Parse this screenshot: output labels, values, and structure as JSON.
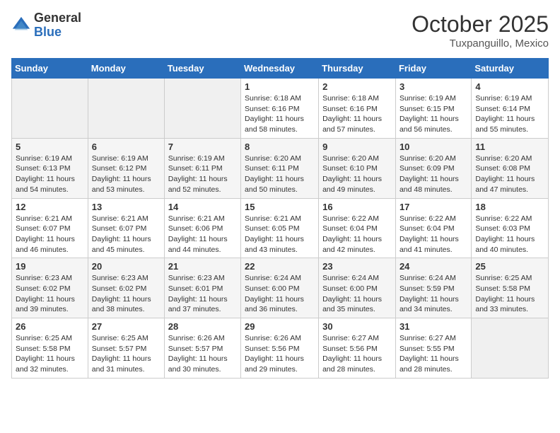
{
  "header": {
    "logo_general": "General",
    "logo_blue": "Blue",
    "month": "October 2025",
    "location": "Tuxpanguillo, Mexico"
  },
  "days_of_week": [
    "Sunday",
    "Monday",
    "Tuesday",
    "Wednesday",
    "Thursday",
    "Friday",
    "Saturday"
  ],
  "weeks": [
    [
      {
        "day": "",
        "info": ""
      },
      {
        "day": "",
        "info": ""
      },
      {
        "day": "",
        "info": ""
      },
      {
        "day": "1",
        "info": "Sunrise: 6:18 AM\nSunset: 6:16 PM\nDaylight: 11 hours\nand 58 minutes."
      },
      {
        "day": "2",
        "info": "Sunrise: 6:18 AM\nSunset: 6:16 PM\nDaylight: 11 hours\nand 57 minutes."
      },
      {
        "day": "3",
        "info": "Sunrise: 6:19 AM\nSunset: 6:15 PM\nDaylight: 11 hours\nand 56 minutes."
      },
      {
        "day": "4",
        "info": "Sunrise: 6:19 AM\nSunset: 6:14 PM\nDaylight: 11 hours\nand 55 minutes."
      }
    ],
    [
      {
        "day": "5",
        "info": "Sunrise: 6:19 AM\nSunset: 6:13 PM\nDaylight: 11 hours\nand 54 minutes."
      },
      {
        "day": "6",
        "info": "Sunrise: 6:19 AM\nSunset: 6:12 PM\nDaylight: 11 hours\nand 53 minutes."
      },
      {
        "day": "7",
        "info": "Sunrise: 6:19 AM\nSunset: 6:11 PM\nDaylight: 11 hours\nand 52 minutes."
      },
      {
        "day": "8",
        "info": "Sunrise: 6:20 AM\nSunset: 6:11 PM\nDaylight: 11 hours\nand 50 minutes."
      },
      {
        "day": "9",
        "info": "Sunrise: 6:20 AM\nSunset: 6:10 PM\nDaylight: 11 hours\nand 49 minutes."
      },
      {
        "day": "10",
        "info": "Sunrise: 6:20 AM\nSunset: 6:09 PM\nDaylight: 11 hours\nand 48 minutes."
      },
      {
        "day": "11",
        "info": "Sunrise: 6:20 AM\nSunset: 6:08 PM\nDaylight: 11 hours\nand 47 minutes."
      }
    ],
    [
      {
        "day": "12",
        "info": "Sunrise: 6:21 AM\nSunset: 6:07 PM\nDaylight: 11 hours\nand 46 minutes."
      },
      {
        "day": "13",
        "info": "Sunrise: 6:21 AM\nSunset: 6:07 PM\nDaylight: 11 hours\nand 45 minutes."
      },
      {
        "day": "14",
        "info": "Sunrise: 6:21 AM\nSunset: 6:06 PM\nDaylight: 11 hours\nand 44 minutes."
      },
      {
        "day": "15",
        "info": "Sunrise: 6:21 AM\nSunset: 6:05 PM\nDaylight: 11 hours\nand 43 minutes."
      },
      {
        "day": "16",
        "info": "Sunrise: 6:22 AM\nSunset: 6:04 PM\nDaylight: 11 hours\nand 42 minutes."
      },
      {
        "day": "17",
        "info": "Sunrise: 6:22 AM\nSunset: 6:04 PM\nDaylight: 11 hours\nand 41 minutes."
      },
      {
        "day": "18",
        "info": "Sunrise: 6:22 AM\nSunset: 6:03 PM\nDaylight: 11 hours\nand 40 minutes."
      }
    ],
    [
      {
        "day": "19",
        "info": "Sunrise: 6:23 AM\nSunset: 6:02 PM\nDaylight: 11 hours\nand 39 minutes."
      },
      {
        "day": "20",
        "info": "Sunrise: 6:23 AM\nSunset: 6:02 PM\nDaylight: 11 hours\nand 38 minutes."
      },
      {
        "day": "21",
        "info": "Sunrise: 6:23 AM\nSunset: 6:01 PM\nDaylight: 11 hours\nand 37 minutes."
      },
      {
        "day": "22",
        "info": "Sunrise: 6:24 AM\nSunset: 6:00 PM\nDaylight: 11 hours\nand 36 minutes."
      },
      {
        "day": "23",
        "info": "Sunrise: 6:24 AM\nSunset: 6:00 PM\nDaylight: 11 hours\nand 35 minutes."
      },
      {
        "day": "24",
        "info": "Sunrise: 6:24 AM\nSunset: 5:59 PM\nDaylight: 11 hours\nand 34 minutes."
      },
      {
        "day": "25",
        "info": "Sunrise: 6:25 AM\nSunset: 5:58 PM\nDaylight: 11 hours\nand 33 minutes."
      }
    ],
    [
      {
        "day": "26",
        "info": "Sunrise: 6:25 AM\nSunset: 5:58 PM\nDaylight: 11 hours\nand 32 minutes."
      },
      {
        "day": "27",
        "info": "Sunrise: 6:25 AM\nSunset: 5:57 PM\nDaylight: 11 hours\nand 31 minutes."
      },
      {
        "day": "28",
        "info": "Sunrise: 6:26 AM\nSunset: 5:57 PM\nDaylight: 11 hours\nand 30 minutes."
      },
      {
        "day": "29",
        "info": "Sunrise: 6:26 AM\nSunset: 5:56 PM\nDaylight: 11 hours\nand 29 minutes."
      },
      {
        "day": "30",
        "info": "Sunrise: 6:27 AM\nSunset: 5:56 PM\nDaylight: 11 hours\nand 28 minutes."
      },
      {
        "day": "31",
        "info": "Sunrise: 6:27 AM\nSunset: 5:55 PM\nDaylight: 11 hours\nand 28 minutes."
      },
      {
        "day": "",
        "info": ""
      }
    ]
  ]
}
